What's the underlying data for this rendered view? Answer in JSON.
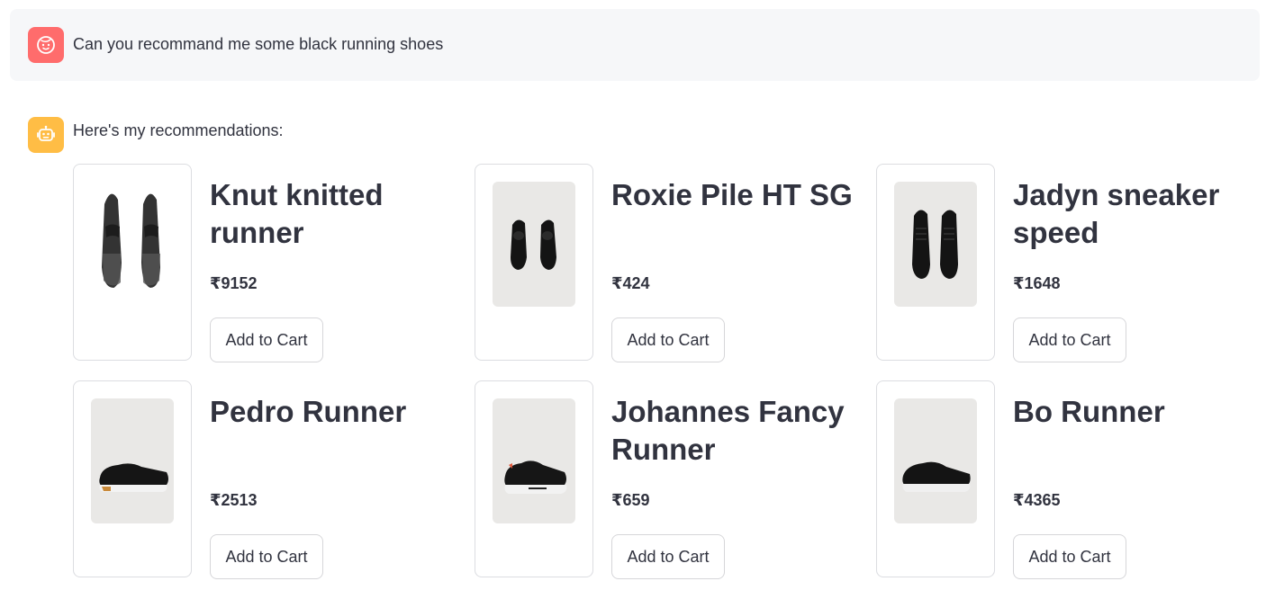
{
  "conversation": {
    "user_message": "Can you recommand me some black running shoes",
    "assistant_message": "Here's my recommendations:"
  },
  "avatars": {
    "user": {
      "icon": "face-icon",
      "color": "#ff6c6c"
    },
    "assistant": {
      "icon": "robot-icon",
      "color": "#ffbd45"
    }
  },
  "products": [
    {
      "name": "Knut knitted runner",
      "price": "₹9152",
      "button": "Add to Cart",
      "image": "pair-top-view"
    },
    {
      "name": "Roxie Pile HT SG",
      "price": "₹424",
      "button": "Add to Cart",
      "image": "pair-top-view"
    },
    {
      "name": "Jadyn sneaker speed",
      "price": "₹1648",
      "button": "Add to Cart",
      "image": "pair-top-view"
    },
    {
      "name": "Pedro Runner",
      "price": "₹2513",
      "button": "Add to Cart",
      "image": "side-view"
    },
    {
      "name": "Johannes Fancy Runner",
      "price": "₹659",
      "button": "Add to Cart",
      "image": "side-view"
    },
    {
      "name": "Bo Runner",
      "price": "₹4365",
      "button": "Add to Cart",
      "image": "side-view"
    }
  ]
}
